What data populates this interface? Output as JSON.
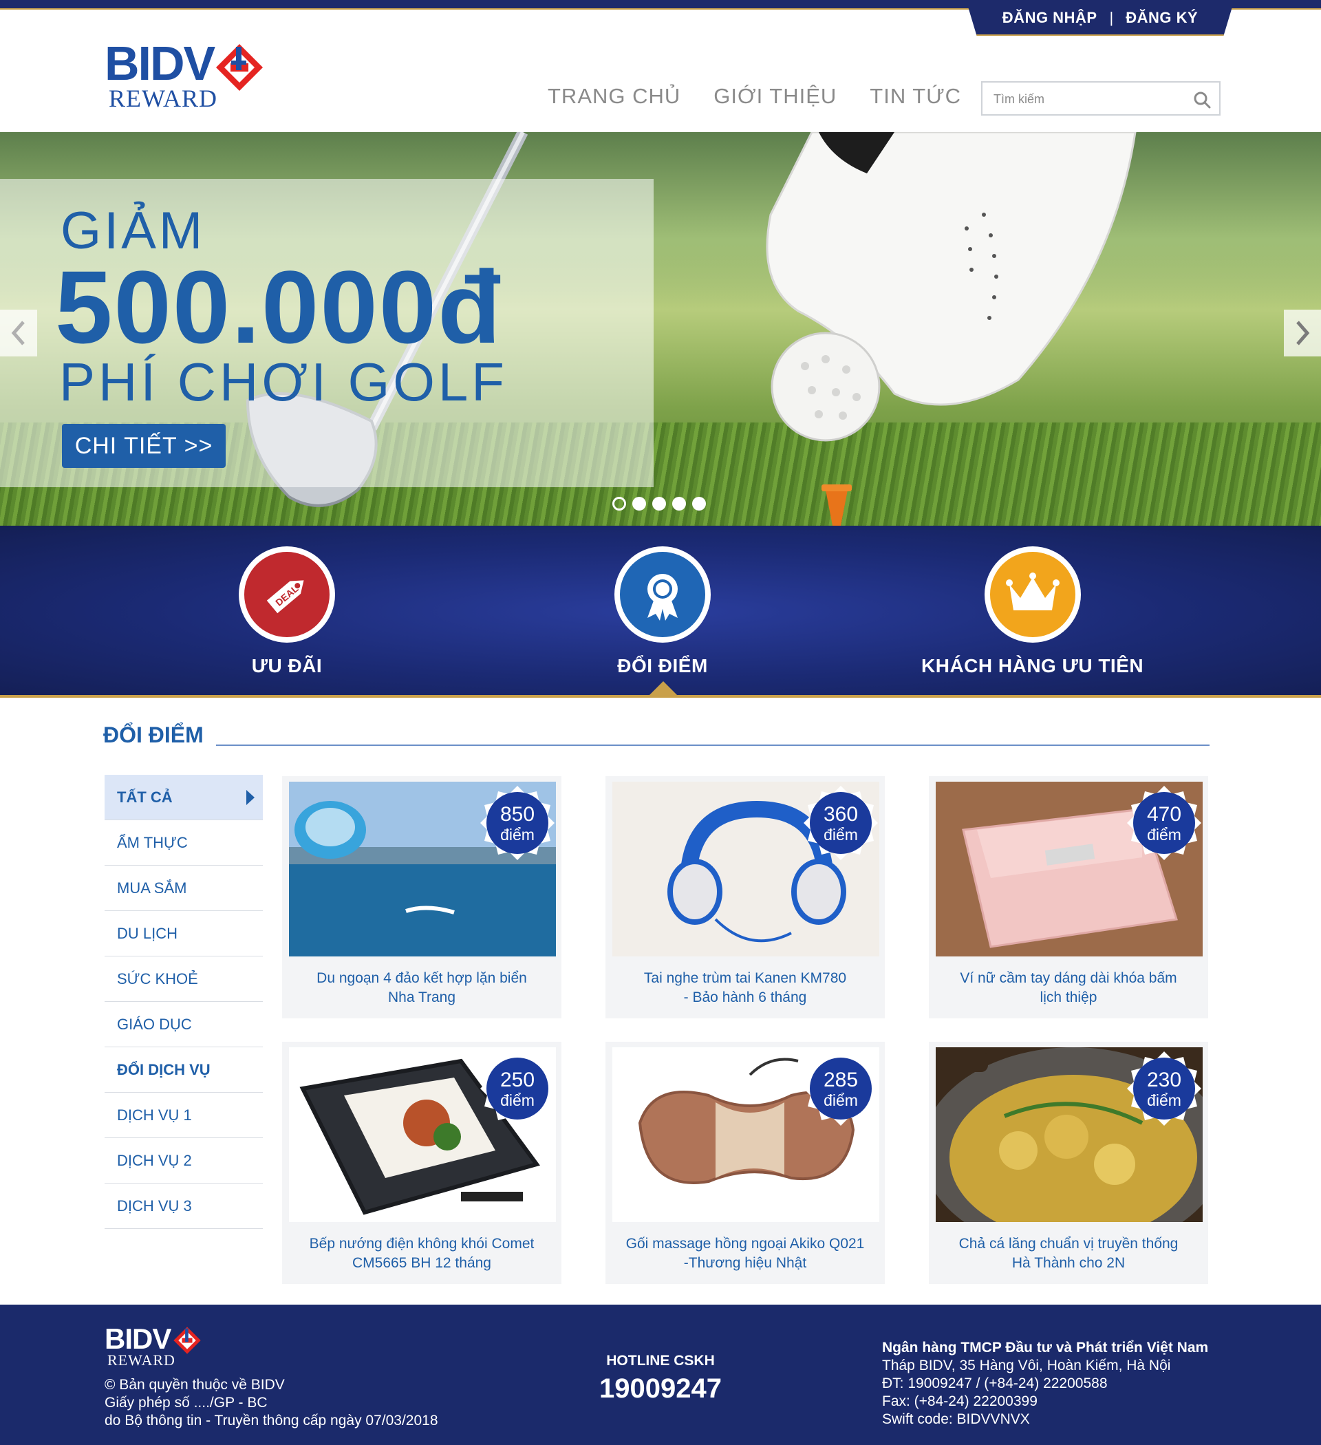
{
  "auth": {
    "login": "ĐĂNG NHẬP",
    "separator": "|",
    "register": "ĐĂNG KÝ"
  },
  "logo": {
    "brand": "BIDV",
    "product": "REWARD"
  },
  "nav": {
    "items": [
      "TRANG CHỦ",
      "GIỚI THIỆU",
      "TIN TỨC"
    ]
  },
  "search": {
    "placeholder": "Tìm kiếm"
  },
  "hero": {
    "line1": "GIẢM",
    "line2": "500.000đ",
    "line3": "PHÍ CHƠI GOLF",
    "cta": "CHI TIẾT >>",
    "slides": 5,
    "active_slide": 1
  },
  "features": [
    {
      "label": "ƯU ĐÃI",
      "icon": "deal-tag-icon",
      "color": "#c0292e"
    },
    {
      "label": "ĐỔI ĐIỂM",
      "icon": "award-ribbon-icon",
      "color": "#1f66b5"
    },
    {
      "label": "KHÁCH HÀNG ƯU TIÊN",
      "icon": "crown-icon",
      "color": "#f2a51c"
    }
  ],
  "section": {
    "title": "ĐỔI ĐIỂM"
  },
  "sidebar": {
    "items": [
      {
        "label": "TẤT CẢ",
        "active": true
      },
      {
        "label": "ẨM THỰC"
      },
      {
        "label": "MUA SẮM"
      },
      {
        "label": "DU LỊCH"
      },
      {
        "label": "SỨC KHOẺ"
      },
      {
        "label": "GIÁO DỤC"
      },
      {
        "label": "ĐỔI DỊCH VỤ",
        "heading": true
      },
      {
        "label": "DỊCH VỤ 1"
      },
      {
        "label": "DỊCH VỤ 2"
      },
      {
        "label": "DỊCH VỤ 3"
      }
    ]
  },
  "products": [
    {
      "points": "850",
      "unit": "điểm",
      "title_l1": "Du ngoạn 4 đảo kết hợp lặn biển",
      "title_l2": "Nha Trang",
      "image": "parasailing-sea-photo"
    },
    {
      "points": "360",
      "unit": "điểm",
      "title_l1": "Tai nghe trùm tai Kanen KM780",
      "title_l2": "- Bảo hành 6 tháng",
      "image": "blue-headphones-photo"
    },
    {
      "points": "470",
      "unit": "điểm",
      "title_l1": "Ví nữ cầm tay dáng dài khóa bấm",
      "title_l2": "lịch thiệp",
      "image": "pink-wallet-photo"
    },
    {
      "points": "250",
      "unit": "điểm",
      "title_l1": "Bếp nướng điện không khói Comet",
      "title_l2": "CM5665 BH 12 tháng",
      "image": "electric-grill-photo"
    },
    {
      "points": "285",
      "unit": "điểm",
      "title_l1": "Gối massage hồng ngoại Akiko Q021",
      "title_l2": "-Thương hiệu Nhật",
      "image": "massage-pillow-photo"
    },
    {
      "points": "230",
      "unit": "điểm",
      "title_l1": "Chả cá lăng chuẩn vị truyền thống",
      "title_l2": "Hà Thành cho 2N",
      "image": "fish-dish-photo"
    }
  ],
  "footer": {
    "brand": "BIDV",
    "product": "REWARD",
    "copyright": "© Bản quyền thuộc về BIDV",
    "license": "Giấy phép số ..../GP - BC",
    "issued": "do Bộ thông tin - Truyền thông cấp ngày 07/03/2018",
    "hotline_label": "HOTLINE CSKH",
    "hotline": "19009247",
    "bank_name": "Ngân hàng TMCP Đầu tư và Phát triển Việt Nam",
    "address": "Tháp BIDV, 35 Hàng Vôi, Hoàn Kiếm, Hà Nội",
    "phone": "ĐT: 19009247 / (+84-24) 22200588",
    "fax": "Fax: (+84-24) 22200399",
    "swift": "Swift code: BIDVVNVX"
  },
  "colors": {
    "brand_blue": "#1f5fa8",
    "navy": "#1b2a6b",
    "gold": "#c9a04a",
    "badge_blue": "#1a3a9c"
  }
}
